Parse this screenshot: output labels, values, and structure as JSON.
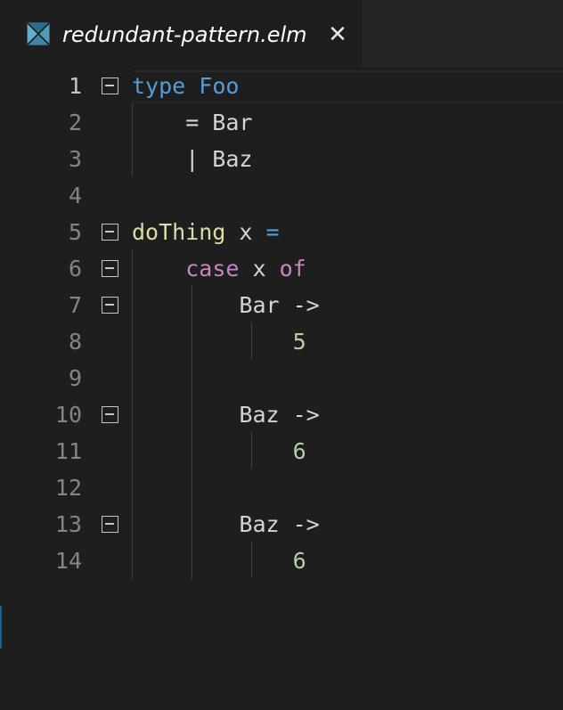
{
  "tab": {
    "title": "redundant-pattern.elm",
    "close_glyph": "✕",
    "icon": "elm-file-icon"
  },
  "colors": {
    "keyword": "#569cd6",
    "control": "#c586c0",
    "function": "#dcdcaa",
    "number": "#b5cea8",
    "text": "#d4d4d4",
    "line_number": "#858585"
  },
  "editor": {
    "lines": [
      {
        "number": "1",
        "tokens": [
          "type",
          " ",
          "Foo"
        ]
      },
      {
        "number": "2",
        "tokens": [
          "    = Bar"
        ]
      },
      {
        "number": "3",
        "tokens": [
          "    | Baz"
        ]
      },
      {
        "number": "4",
        "tokens": []
      },
      {
        "number": "5",
        "tokens": [
          "doThing",
          " x ",
          "="
        ]
      },
      {
        "number": "6",
        "tokens": [
          "    ",
          "case",
          " x ",
          "of"
        ]
      },
      {
        "number": "7",
        "tokens": [
          "        Bar ->"
        ]
      },
      {
        "number": "8",
        "tokens": [
          "            ",
          "5"
        ]
      },
      {
        "number": "9",
        "tokens": []
      },
      {
        "number": "10",
        "tokens": [
          "        Baz ->"
        ]
      },
      {
        "number": "11",
        "tokens": [
          "            ",
          "6"
        ]
      },
      {
        "number": "12",
        "tokens": []
      },
      {
        "number": "13",
        "tokens": [
          "        Baz ->"
        ]
      },
      {
        "number": "14",
        "tokens": [
          "            ",
          "6"
        ]
      }
    ]
  }
}
